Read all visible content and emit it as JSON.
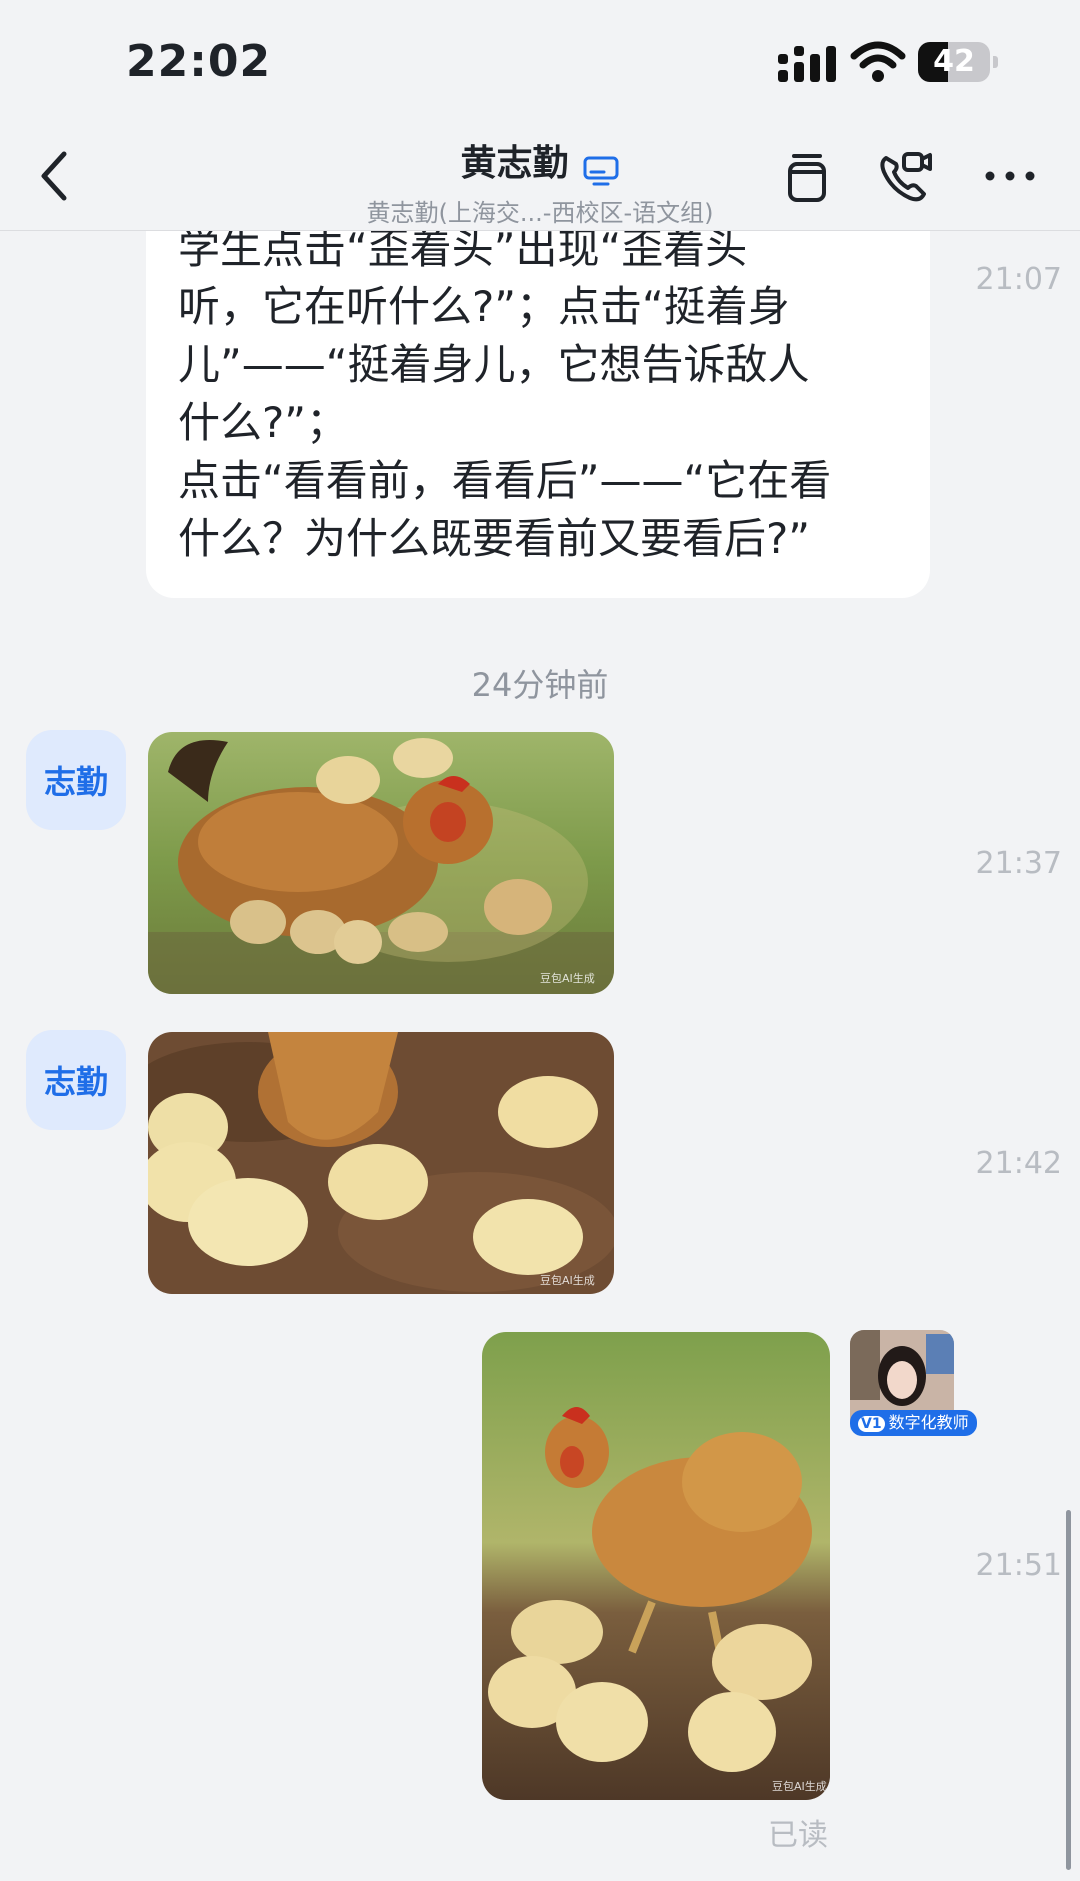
{
  "status_bar": {
    "time": "22:02",
    "battery_level": "42",
    "battery_fraction": 0.42
  },
  "header": {
    "title": "黄志勤",
    "subtitle": "黄志勤(上海交...-西校区-语文组)",
    "icons": [
      "back-arrow-icon",
      "desktop-icon",
      "cup-icon",
      "video-call-icon",
      "more-icon"
    ]
  },
  "messages": [
    {
      "type": "text",
      "lines": [
        "学生点击“歪着头”出现“歪着头",
        "听，它在听什么?”；点击“挺着身",
        "儿”——“挺着身儿，它想告诉敌人",
        "什么?”；",
        "点击“看看前，看看后”——“它在看",
        "什么？为什么既要看前又要看后?”"
      ],
      "time": "21:07"
    },
    {
      "type": "separator",
      "text": "24分钟前"
    },
    {
      "type": "image",
      "sender": "志勤",
      "time": "21:37",
      "watermark": "豆包AI生成"
    },
    {
      "type": "image",
      "sender": "志勤",
      "time": "21:42",
      "watermark": "豆包AI生成"
    },
    {
      "type": "image",
      "sender_badge": "数字化教师",
      "sender_badge_prefix": "V1",
      "time": "21:51",
      "watermark": "豆包AI生成",
      "status": "已读"
    }
  ]
}
